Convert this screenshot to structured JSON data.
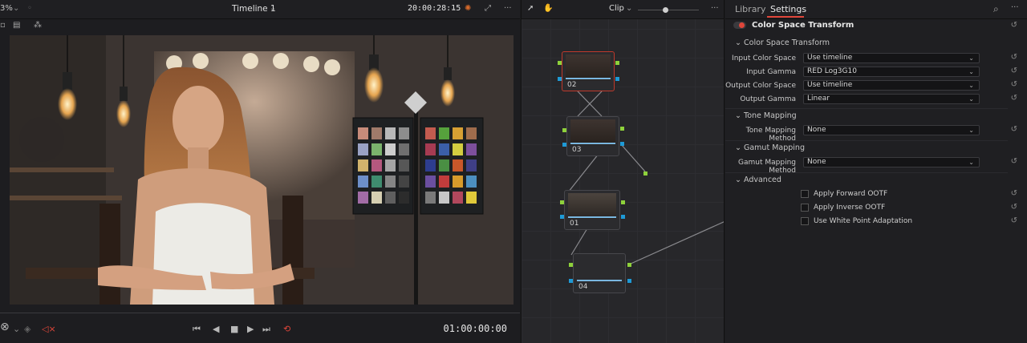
{
  "viewer": {
    "zoom": "3%",
    "timeline_name": "Timeline 1",
    "source_timecode": "20:00:28:15",
    "record_timecode": "01:00:00:00"
  },
  "nodes_panel": {
    "mode_label": "Clip",
    "nodes": [
      {
        "label": "02"
      },
      {
        "label": "03"
      },
      {
        "label": "01"
      },
      {
        "label": "04"
      }
    ]
  },
  "settings": {
    "tabs": [
      "Library",
      "Settings"
    ],
    "effect_title": "Color Space Transform",
    "sections": {
      "cst": "Color Space Transform",
      "tone": "Tone Mapping",
      "gamut": "Gamut Mapping",
      "advanced": "Advanced"
    },
    "fields": {
      "input_color_space": {
        "label": "Input Color Space",
        "value": "Use timeline"
      },
      "input_gamma": {
        "label": "Input Gamma",
        "value": "RED Log3G10"
      },
      "output_color_space": {
        "label": "Output Color Space",
        "value": "Use timeline"
      },
      "output_gamma": {
        "label": "Output Gamma",
        "value": "Linear"
      },
      "tone_mapping_method": {
        "label": "Tone Mapping Method",
        "value": "None"
      },
      "gamut_mapping_method": {
        "label": "Gamut Mapping Method",
        "value": "None"
      }
    },
    "checkboxes": {
      "apply_forward_ootf": "Apply Forward OOTF",
      "apply_inverse_ootf": "Apply Inverse OOTF",
      "use_white_point_adaptation": "Use White Point Adaptation"
    }
  },
  "colors": {
    "accent_red": "#e0463a",
    "port_green": "#8ed13b",
    "port_blue": "#1e9ad6"
  }
}
